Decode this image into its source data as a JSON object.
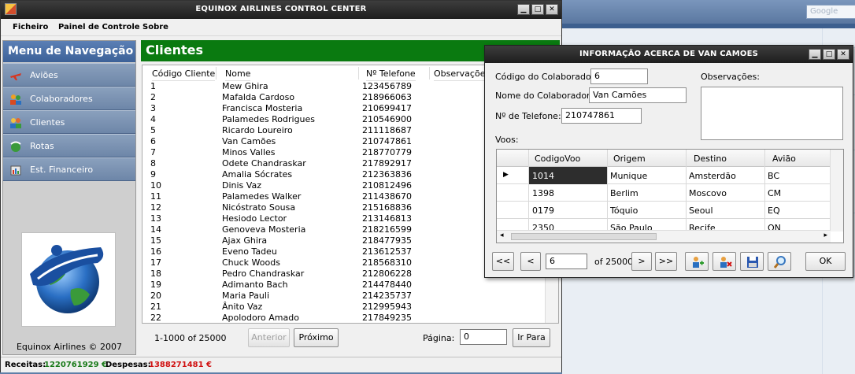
{
  "main_window": {
    "title": "EQUINOX AIRLINES CONTROL CENTER",
    "menu": [
      "Ficheiro",
      "Painel de Controle",
      "Sobre"
    ]
  },
  "sidebar": {
    "header": "Menu de Navegação",
    "items": [
      {
        "label": "Aviões",
        "icon": "airplane-icon"
      },
      {
        "label": "Colaboradores",
        "icon": "people-icon"
      },
      {
        "label": "Clientes",
        "icon": "clients-icon"
      },
      {
        "label": "Rotas",
        "icon": "route-globe-icon"
      },
      {
        "label": "Est. Financeiro",
        "icon": "finance-icon"
      }
    ],
    "copyright": "Equinox Airlines © 2007"
  },
  "clients": {
    "header": "Clientes",
    "columns": [
      "Código Cliente",
      "Nome",
      "Nº Telefone",
      "Observações"
    ],
    "rows": [
      [
        "1",
        "Mew Ghira",
        "123456789"
      ],
      [
        "2",
        "Mafalda Cardoso",
        "218966063"
      ],
      [
        "3",
        "Francisca Mosteria",
        "210699417"
      ],
      [
        "4",
        "Palamedes Rodrigues",
        "210546900"
      ],
      [
        "5",
        "Ricardo Loureiro",
        "211118687"
      ],
      [
        "6",
        "Van Camões",
        "210747861"
      ],
      [
        "7",
        "Minos Valles",
        "218770779"
      ],
      [
        "8",
        "Odete Chandraskar",
        "217892917"
      ],
      [
        "9",
        "Amalia Sócrates",
        "212363836"
      ],
      [
        "10",
        "Dinis Vaz",
        "210812496"
      ],
      [
        "11",
        "Palamedes Walker",
        "211438670"
      ],
      [
        "12",
        "Nicóstrato Sousa",
        "215168836"
      ],
      [
        "13",
        "Hesiodo Lector",
        "213146813"
      ],
      [
        "14",
        "Genoveva Mosteria",
        "218216599"
      ],
      [
        "15",
        "Ajax Ghira",
        "218477935"
      ],
      [
        "16",
        "Eveno Tadeu",
        "213612537"
      ],
      [
        "17",
        "Chuck Woods",
        "218568310"
      ],
      [
        "18",
        "Pedro Chandraskar",
        "212806228"
      ],
      [
        "19",
        "Adimanto Bach",
        "214478440"
      ],
      [
        "20",
        "Maria Pauli",
        "214235737"
      ],
      [
        "21",
        "Ânito Vaz",
        "212995943"
      ],
      [
        "22",
        "Apolodoro Amado",
        "217849235"
      ]
    ],
    "pager": {
      "range": "1-1000 of 25000",
      "prev_label": "Anterior",
      "next_label": "Próximo",
      "page_label": "Página:",
      "page_value": "0",
      "goto_label": "Ir Para"
    }
  },
  "status": {
    "receitas_label": "Receitas:",
    "receitas_value": "1220761929 €",
    "receitas_color": "#1a7a1a",
    "despesas_label": "Despesas:",
    "despesas_value": "1388271481 €",
    "despesas_color": "#d01010"
  },
  "dialog": {
    "title": "INFORMAÇÃO ACERCA DE VAN CAMOES",
    "codigo_label": "Código do Colaborador:",
    "codigo_value": "6",
    "nome_label": "Nome do Colaborador:",
    "nome_value": "Van Camões",
    "telefone_label": "Nº de Telefone:",
    "telefone_value": "210747861",
    "observacoes_label": "Observações:",
    "voos_label": "Voos:",
    "voos_columns": [
      "CodigoVoo",
      "Origem",
      "Destino",
      "Avião"
    ],
    "voos_rows": [
      [
        "1014",
        "Munique",
        "Amsterdão",
        "BC"
      ],
      [
        "1398",
        "Berlim",
        "Moscovo",
        "CM"
      ],
      [
        "0179",
        "Tóquio",
        "Seoul",
        "EQ"
      ],
      [
        "2350",
        "São Paulo",
        "Recife",
        "QN"
      ]
    ],
    "nav": {
      "first": "<<",
      "prev": "<",
      "position": "6",
      "of_label": "of 25000",
      "next": ">",
      "last": ">>"
    },
    "ok_label": "OK"
  },
  "background": {
    "search_placeholder": "Google"
  }
}
